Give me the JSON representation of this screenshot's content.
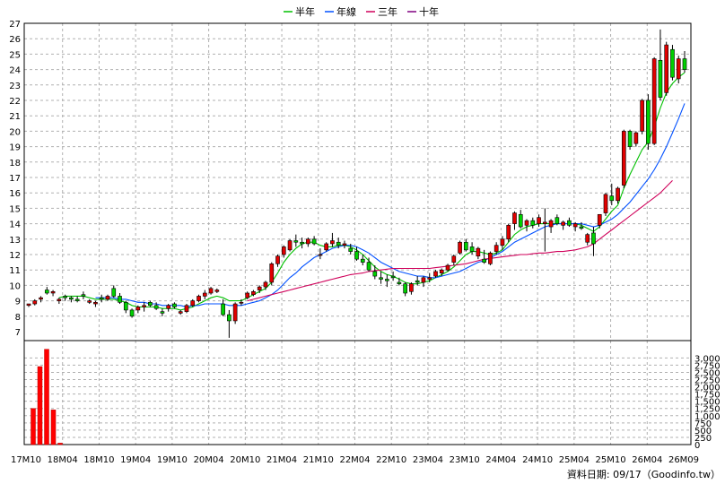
{
  "chart_data": {
    "type": "candlestick",
    "legend": [
      {
        "label": "半年",
        "color": "#00c000"
      },
      {
        "label": "年線",
        "color": "#0050ff"
      },
      {
        "label": "三年",
        "color": "#d0005a"
      },
      {
        "label": "十年",
        "color": "#800080"
      }
    ],
    "price_axis": {
      "ylim": [
        7,
        27
      ],
      "ticks": [
        7,
        8,
        9,
        10,
        11,
        12,
        13,
        14,
        15,
        16,
        17,
        18,
        19,
        20,
        21,
        22,
        23,
        24,
        25,
        26,
        27
      ]
    },
    "volume_axis": {
      "ylim": [
        0,
        3600
      ],
      "ticks": [
        "0",
        "250",
        "500",
        "750",
        "1,000",
        "1,250",
        "1,500",
        "1,750",
        "2,000",
        "2,250",
        "2,500",
        "2,750",
        "3,000"
      ],
      "tick_values": [
        0,
        250,
        500,
        750,
        1000,
        1250,
        1500,
        1750,
        2000,
        2250,
        2500,
        2750,
        3000
      ]
    },
    "x_labels": [
      "17M10",
      "18M04",
      "18M10",
      "19M04",
      "19M10",
      "20M04",
      "20M10",
      "21M04",
      "21M10",
      "22M04",
      "22M10",
      "23M04",
      "23M10",
      "24M04",
      "24M10",
      "25M04",
      "25M10",
      "26M04",
      "26M09"
    ],
    "candles": [
      [
        8.7,
        8.8,
        8.6,
        8.8
      ],
      [
        8.8,
        9.1,
        8.7,
        9.0
      ],
      [
        9.1,
        9.3,
        8.9,
        9.2
      ],
      [
        9.7,
        9.9,
        9.4,
        9.5
      ],
      [
        9.5,
        9.7,
        9.3,
        9.6
      ],
      [
        9.0,
        9.2,
        8.8,
        9.1
      ],
      [
        9.3,
        9.4,
        9.0,
        9.2
      ],
      [
        9.2,
        9.3,
        8.9,
        9.1
      ],
      [
        9.1,
        9.3,
        8.9,
        9.0
      ],
      [
        9.4,
        9.6,
        9.1,
        9.3
      ],
      [
        8.9,
        9.1,
        8.8,
        9.0
      ],
      [
        8.8,
        9.0,
        8.6,
        8.9
      ],
      [
        9.2,
        9.4,
        8.9,
        9.1
      ],
      [
        9.1,
        9.4,
        9.0,
        9.3
      ],
      [
        9.8,
        10.0,
        9.2,
        9.3
      ],
      [
        9.3,
        9.5,
        8.8,
        8.9
      ],
      [
        8.9,
        9.0,
        8.2,
        8.4
      ],
      [
        8.4,
        8.5,
        7.9,
        8.0
      ],
      [
        8.4,
        8.7,
        8.2,
        8.6
      ],
      [
        8.6,
        8.9,
        8.3,
        8.7
      ],
      [
        8.9,
        9.0,
        8.6,
        8.7
      ],
      [
        8.7,
        8.9,
        8.4,
        8.5
      ],
      [
        8.3,
        8.5,
        8.0,
        8.2
      ],
      [
        8.5,
        8.8,
        8.3,
        8.7
      ],
      [
        8.8,
        8.9,
        8.5,
        8.6
      ],
      [
        8.2,
        8.4,
        8.1,
        8.3
      ],
      [
        8.3,
        8.8,
        8.2,
        8.7
      ],
      [
        8.7,
        9.1,
        8.6,
        9.0
      ],
      [
        9.0,
        9.4,
        8.9,
        9.3
      ],
      [
        9.3,
        9.7,
        9.1,
        9.5
      ],
      [
        9.5,
        9.9,
        9.4,
        9.8
      ],
      [
        9.6,
        9.8,
        9.5,
        9.7
      ],
      [
        8.8,
        9.1,
        8.0,
        8.1
      ],
      [
        8.1,
        8.4,
        6.6,
        7.7
      ],
      [
        7.7,
        8.9,
        7.5,
        8.8
      ],
      [
        8.9,
        9.1,
        8.7,
        8.9
      ],
      [
        9.2,
        9.6,
        9.1,
        9.5
      ],
      [
        9.4,
        9.7,
        9.3,
        9.6
      ],
      [
        9.7,
        10.0,
        9.5,
        9.9
      ],
      [
        9.9,
        10.3,
        9.7,
        10.2
      ],
      [
        10.2,
        11.5,
        10.0,
        11.4
      ],
      [
        11.4,
        12.0,
        11.2,
        11.9
      ],
      [
        12.0,
        12.6,
        11.8,
        12.5
      ],
      [
        12.3,
        13.0,
        12.2,
        12.9
      ],
      [
        12.9,
        13.3,
        12.5,
        12.8
      ],
      [
        12.8,
        13.1,
        12.4,
        12.7
      ],
      [
        12.7,
        13.1,
        12.5,
        13.0
      ],
      [
        13.0,
        13.2,
        12.6,
        12.7
      ],
      [
        12.0,
        12.4,
        11.7,
        12.0
      ],
      [
        12.3,
        12.8,
        12.2,
        12.7
      ],
      [
        12.7,
        13.4,
        12.5,
        12.9
      ],
      [
        12.8,
        13.1,
        12.4,
        12.6
      ],
      [
        12.6,
        12.9,
        12.4,
        12.7
      ],
      [
        12.4,
        12.7,
        12.0,
        12.2
      ],
      [
        12.2,
        12.5,
        11.6,
        11.7
      ],
      [
        11.7,
        12.0,
        11.3,
        11.5
      ],
      [
        11.5,
        11.8,
        10.9,
        11.0
      ],
      [
        10.9,
        11.3,
        10.4,
        10.6
      ],
      [
        10.5,
        10.9,
        10.1,
        10.4
      ],
      [
        10.4,
        10.7,
        9.9,
        10.3
      ],
      [
        10.6,
        10.9,
        10.3,
        10.5
      ],
      [
        10.2,
        10.5,
        10.0,
        10.1
      ],
      [
        10.1,
        10.2,
        9.3,
        9.5
      ],
      [
        9.6,
        10.2,
        9.4,
        10.1
      ],
      [
        10.3,
        10.6,
        10.0,
        10.2
      ],
      [
        10.2,
        10.6,
        9.9,
        10.5
      ],
      [
        10.4,
        10.8,
        10.2,
        10.5
      ],
      [
        10.6,
        11.0,
        10.5,
        10.9
      ],
      [
        10.8,
        11.1,
        10.6,
        11.0
      ],
      [
        11.0,
        11.4,
        10.9,
        11.3
      ],
      [
        11.5,
        12.0,
        11.3,
        11.9
      ],
      [
        12.1,
        12.9,
        12.0,
        12.8
      ],
      [
        12.8,
        13.0,
        12.2,
        12.3
      ],
      [
        12.5,
        12.8,
        12.0,
        12.2
      ],
      [
        11.9,
        12.5,
        11.7,
        12.4
      ],
      [
        11.7,
        12.3,
        11.4,
        11.5
      ],
      [
        11.4,
        12.2,
        11.3,
        12.1
      ],
      [
        12.2,
        12.8,
        12.0,
        12.6
      ],
      [
        12.6,
        13.2,
        12.3,
        13.0
      ],
      [
        13.0,
        14.0,
        12.8,
        13.9
      ],
      [
        14.0,
        14.8,
        13.6,
        14.7
      ],
      [
        14.6,
        14.9,
        13.7,
        13.8
      ],
      [
        13.9,
        14.3,
        13.5,
        14.2
      ],
      [
        14.2,
        14.4,
        13.7,
        13.9
      ],
      [
        14.0,
        14.6,
        13.8,
        14.4
      ],
      [
        14.0,
        15.0,
        12.2,
        14.1
      ],
      [
        13.8,
        14.3,
        13.4,
        14.2
      ],
      [
        14.4,
        14.6,
        13.9,
        14.0
      ],
      [
        13.9,
        14.2,
        13.6,
        14.1
      ],
      [
        14.2,
        14.4,
        13.8,
        13.9
      ],
      [
        13.8,
        14.1,
        13.5,
        14.0
      ],
      [
        13.8,
        14.1,
        13.6,
        13.7
      ],
      [
        12.8,
        13.4,
        12.6,
        13.3
      ],
      [
        13.4,
        13.8,
        11.9,
        12.7
      ],
      [
        13.9,
        14.6,
        13.7,
        14.6
      ],
      [
        14.7,
        16.0,
        14.5,
        15.9
      ],
      [
        15.8,
        16.6,
        15.2,
        15.5
      ],
      [
        15.5,
        16.4,
        15.3,
        16.3
      ],
      [
        16.5,
        20.1,
        16.3,
        20.0
      ],
      [
        20.0,
        20.1,
        18.8,
        19.0
      ],
      [
        19.2,
        20.0,
        19.0,
        19.9
      ],
      [
        20.0,
        22.1,
        19.8,
        22.0
      ],
      [
        22.0,
        22.4,
        18.8,
        19.2
      ],
      [
        19.2,
        24.8,
        19.1,
        24.7
      ],
      [
        24.6,
        26.6,
        22.0,
        22.2
      ],
      [
        22.5,
        25.8,
        22.3,
        25.6
      ],
      [
        25.3,
        25.6,
        23.3,
        23.5
      ],
      [
        23.4,
        24.9,
        23.1,
        24.7
      ],
      [
        24.7,
        25.2,
        23.8,
        24.0
      ]
    ],
    "volume_bars": [
      {
        "x_label_between": [
          "17M10",
          "18M04"
        ],
        "values": [
          1250,
          2700,
          3300,
          1200,
          50
        ]
      }
    ],
    "series": [
      {
        "name": "半年",
        "values": [
          null,
          null,
          null,
          null,
          null,
          9.2,
          9.3,
          9.3,
          9.3,
          9.3,
          9.2,
          9.1,
          9.1,
          9.1,
          9.1,
          9.0,
          8.9,
          8.7,
          8.6,
          8.6,
          8.6,
          8.6,
          8.5,
          8.5,
          8.5,
          8.4,
          8.5,
          8.6,
          8.8,
          9.0,
          9.2,
          9.3,
          9.2,
          9.0,
          9.0,
          9.0,
          9.2,
          9.4,
          9.6,
          9.8,
          10.2,
          10.8,
          11.5,
          12.0,
          12.4,
          12.7,
          12.8,
          12.8,
          12.6,
          12.5,
          12.5,
          12.6,
          12.6,
          12.5,
          12.3,
          12.0,
          11.6,
          11.2,
          10.9,
          10.7,
          10.6,
          10.4,
          10.2,
          10.1,
          10.1,
          10.2,
          10.3,
          10.5,
          10.7,
          10.9,
          11.2,
          11.6,
          12.0,
          12.2,
          12.2,
          12.1,
          12.0,
          12.1,
          12.3,
          12.8,
          13.3,
          13.6,
          13.8,
          13.9,
          14.0,
          14.0,
          14.0,
          14.0,
          14.0,
          14.0,
          14.0,
          13.9,
          13.7,
          13.5,
          13.8,
          14.3,
          14.8,
          15.2,
          16.3,
          17.2,
          18.0,
          18.8,
          19.3,
          20.3,
          21.5,
          22.5,
          23.1,
          23.5,
          23.8
        ]
      },
      {
        "name": "年線",
        "values": [
          null,
          null,
          null,
          null,
          null,
          null,
          null,
          null,
          null,
          null,
          null,
          9.2,
          9.2,
          9.2,
          9.2,
          9.1,
          9.1,
          9.0,
          8.9,
          8.9,
          8.8,
          8.8,
          8.7,
          8.7,
          8.7,
          8.7,
          8.6,
          8.7,
          8.7,
          8.8,
          8.8,
          8.8,
          8.8,
          8.7,
          8.7,
          8.7,
          8.8,
          8.9,
          9.0,
          9.2,
          9.4,
          9.7,
          10.1,
          10.5,
          10.8,
          11.2,
          11.5,
          11.8,
          12.0,
          12.2,
          12.4,
          12.5,
          12.6,
          12.6,
          12.5,
          12.3,
          12.1,
          11.8,
          11.5,
          11.3,
          11.1,
          10.9,
          10.8,
          10.7,
          10.6,
          10.6,
          10.5,
          10.5,
          10.6,
          10.7,
          10.8,
          10.9,
          11.1,
          11.3,
          11.5,
          11.6,
          11.8,
          12.0,
          12.2,
          12.5,
          12.8,
          13.0,
          13.2,
          13.4,
          13.6,
          13.8,
          13.9,
          14.0,
          14.0,
          14.0,
          14.0,
          14.0,
          13.9,
          13.8,
          13.9,
          14.1,
          14.3,
          14.6,
          15.0,
          15.4,
          15.9,
          16.4,
          16.9,
          17.5,
          18.2,
          19.0,
          19.9,
          20.8,
          21.8
        ]
      },
      {
        "name": "三年",
        "values": [
          null,
          null,
          null,
          null,
          null,
          null,
          null,
          null,
          null,
          null,
          null,
          null,
          null,
          null,
          null,
          null,
          null,
          null,
          null,
          null,
          null,
          null,
          null,
          null,
          null,
          null,
          null,
          null,
          null,
          null,
          null,
          null,
          null,
          null,
          null,
          null,
          9.0,
          9.1,
          9.2,
          9.3,
          9.4,
          9.5,
          9.6,
          9.7,
          9.8,
          9.9,
          10.0,
          10.1,
          10.2,
          10.3,
          10.4,
          10.5,
          10.6,
          10.7,
          10.75,
          10.8,
          10.9,
          10.95,
          11.0,
          11.05,
          11.1,
          11.1,
          11.1,
          11.1,
          11.1,
          11.1,
          11.1,
          11.15,
          11.2,
          11.25,
          11.3,
          11.35,
          11.4,
          11.5,
          11.6,
          11.7,
          11.75,
          11.8,
          11.85,
          11.9,
          11.95,
          12.0,
          12.0,
          12.05,
          12.1,
          12.1,
          12.15,
          12.2,
          12.2,
          12.25,
          12.3,
          12.4,
          12.5,
          12.7,
          13.0,
          13.3,
          13.6,
          13.9,
          14.2,
          14.5,
          14.8,
          15.1,
          15.4,
          15.7,
          16.0,
          16.4,
          16.8
        ]
      },
      {
        "name": "十年",
        "values": []
      }
    ]
  },
  "credit": "資料日期: 09/17（Goodinfo.tw）"
}
